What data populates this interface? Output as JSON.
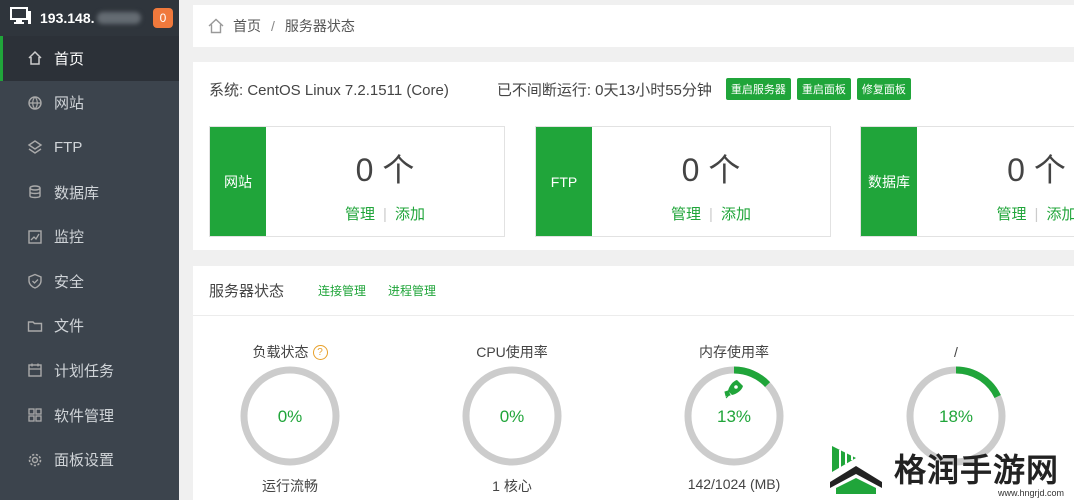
{
  "sidebar": {
    "ip": "193.148.",
    "badge": "0",
    "items": [
      {
        "label": "首页",
        "icon": "home-icon"
      },
      {
        "label": "网站",
        "icon": "globe-icon"
      },
      {
        "label": "FTP",
        "icon": "ftp-icon"
      },
      {
        "label": "数据库",
        "icon": "database-icon"
      },
      {
        "label": "监控",
        "icon": "monitor-icon"
      },
      {
        "label": "安全",
        "icon": "shield-icon"
      },
      {
        "label": "文件",
        "icon": "folder-icon"
      },
      {
        "label": "计划任务",
        "icon": "calendar-icon"
      },
      {
        "label": "软件管理",
        "icon": "grid-icon"
      },
      {
        "label": "面板设置",
        "icon": "gear-icon"
      }
    ]
  },
  "breadcrumb": {
    "home": "首页",
    "separator": "/",
    "current": "服务器状态"
  },
  "system": {
    "os": "系统: CentOS Linux 7.2.1511 (Core)",
    "uptime": "已不间断运行: 0天13小时55分钟",
    "buttons": [
      "重启服务器",
      "重启面板",
      "修复面板"
    ]
  },
  "cards": [
    {
      "label": "网站",
      "count": "0 个",
      "manage": "管理",
      "add": "添加"
    },
    {
      "label": "FTP",
      "count": "0 个",
      "manage": "管理",
      "add": "添加"
    },
    {
      "label": "数据库",
      "count": "0 个",
      "manage": "管理",
      "add": "添加"
    }
  ],
  "status": {
    "title": "服务器状态",
    "links": [
      "连接管理",
      "进程管理"
    ],
    "gauges": [
      {
        "title": "负载状态",
        "help": "?",
        "percent": "0%",
        "value": 0,
        "bottom": "运行流畅"
      },
      {
        "title": "CPU使用率",
        "percent": "0%",
        "value": 0,
        "bottom": "1 核心"
      },
      {
        "title": "内存使用率",
        "percent": "13%",
        "value": 13,
        "bottom": "142/1024 (MB)"
      },
      {
        "title": "/",
        "percent": "18%",
        "value": 18,
        "bottom": ""
      }
    ]
  },
  "watermark": {
    "text": "格润手游网",
    "url": "www.hngrjd.com"
  },
  "colors": {
    "accent": "#20a53a",
    "sidebar": "#3c444d",
    "badge": "#f0793c",
    "track": "#cccccc"
  }
}
